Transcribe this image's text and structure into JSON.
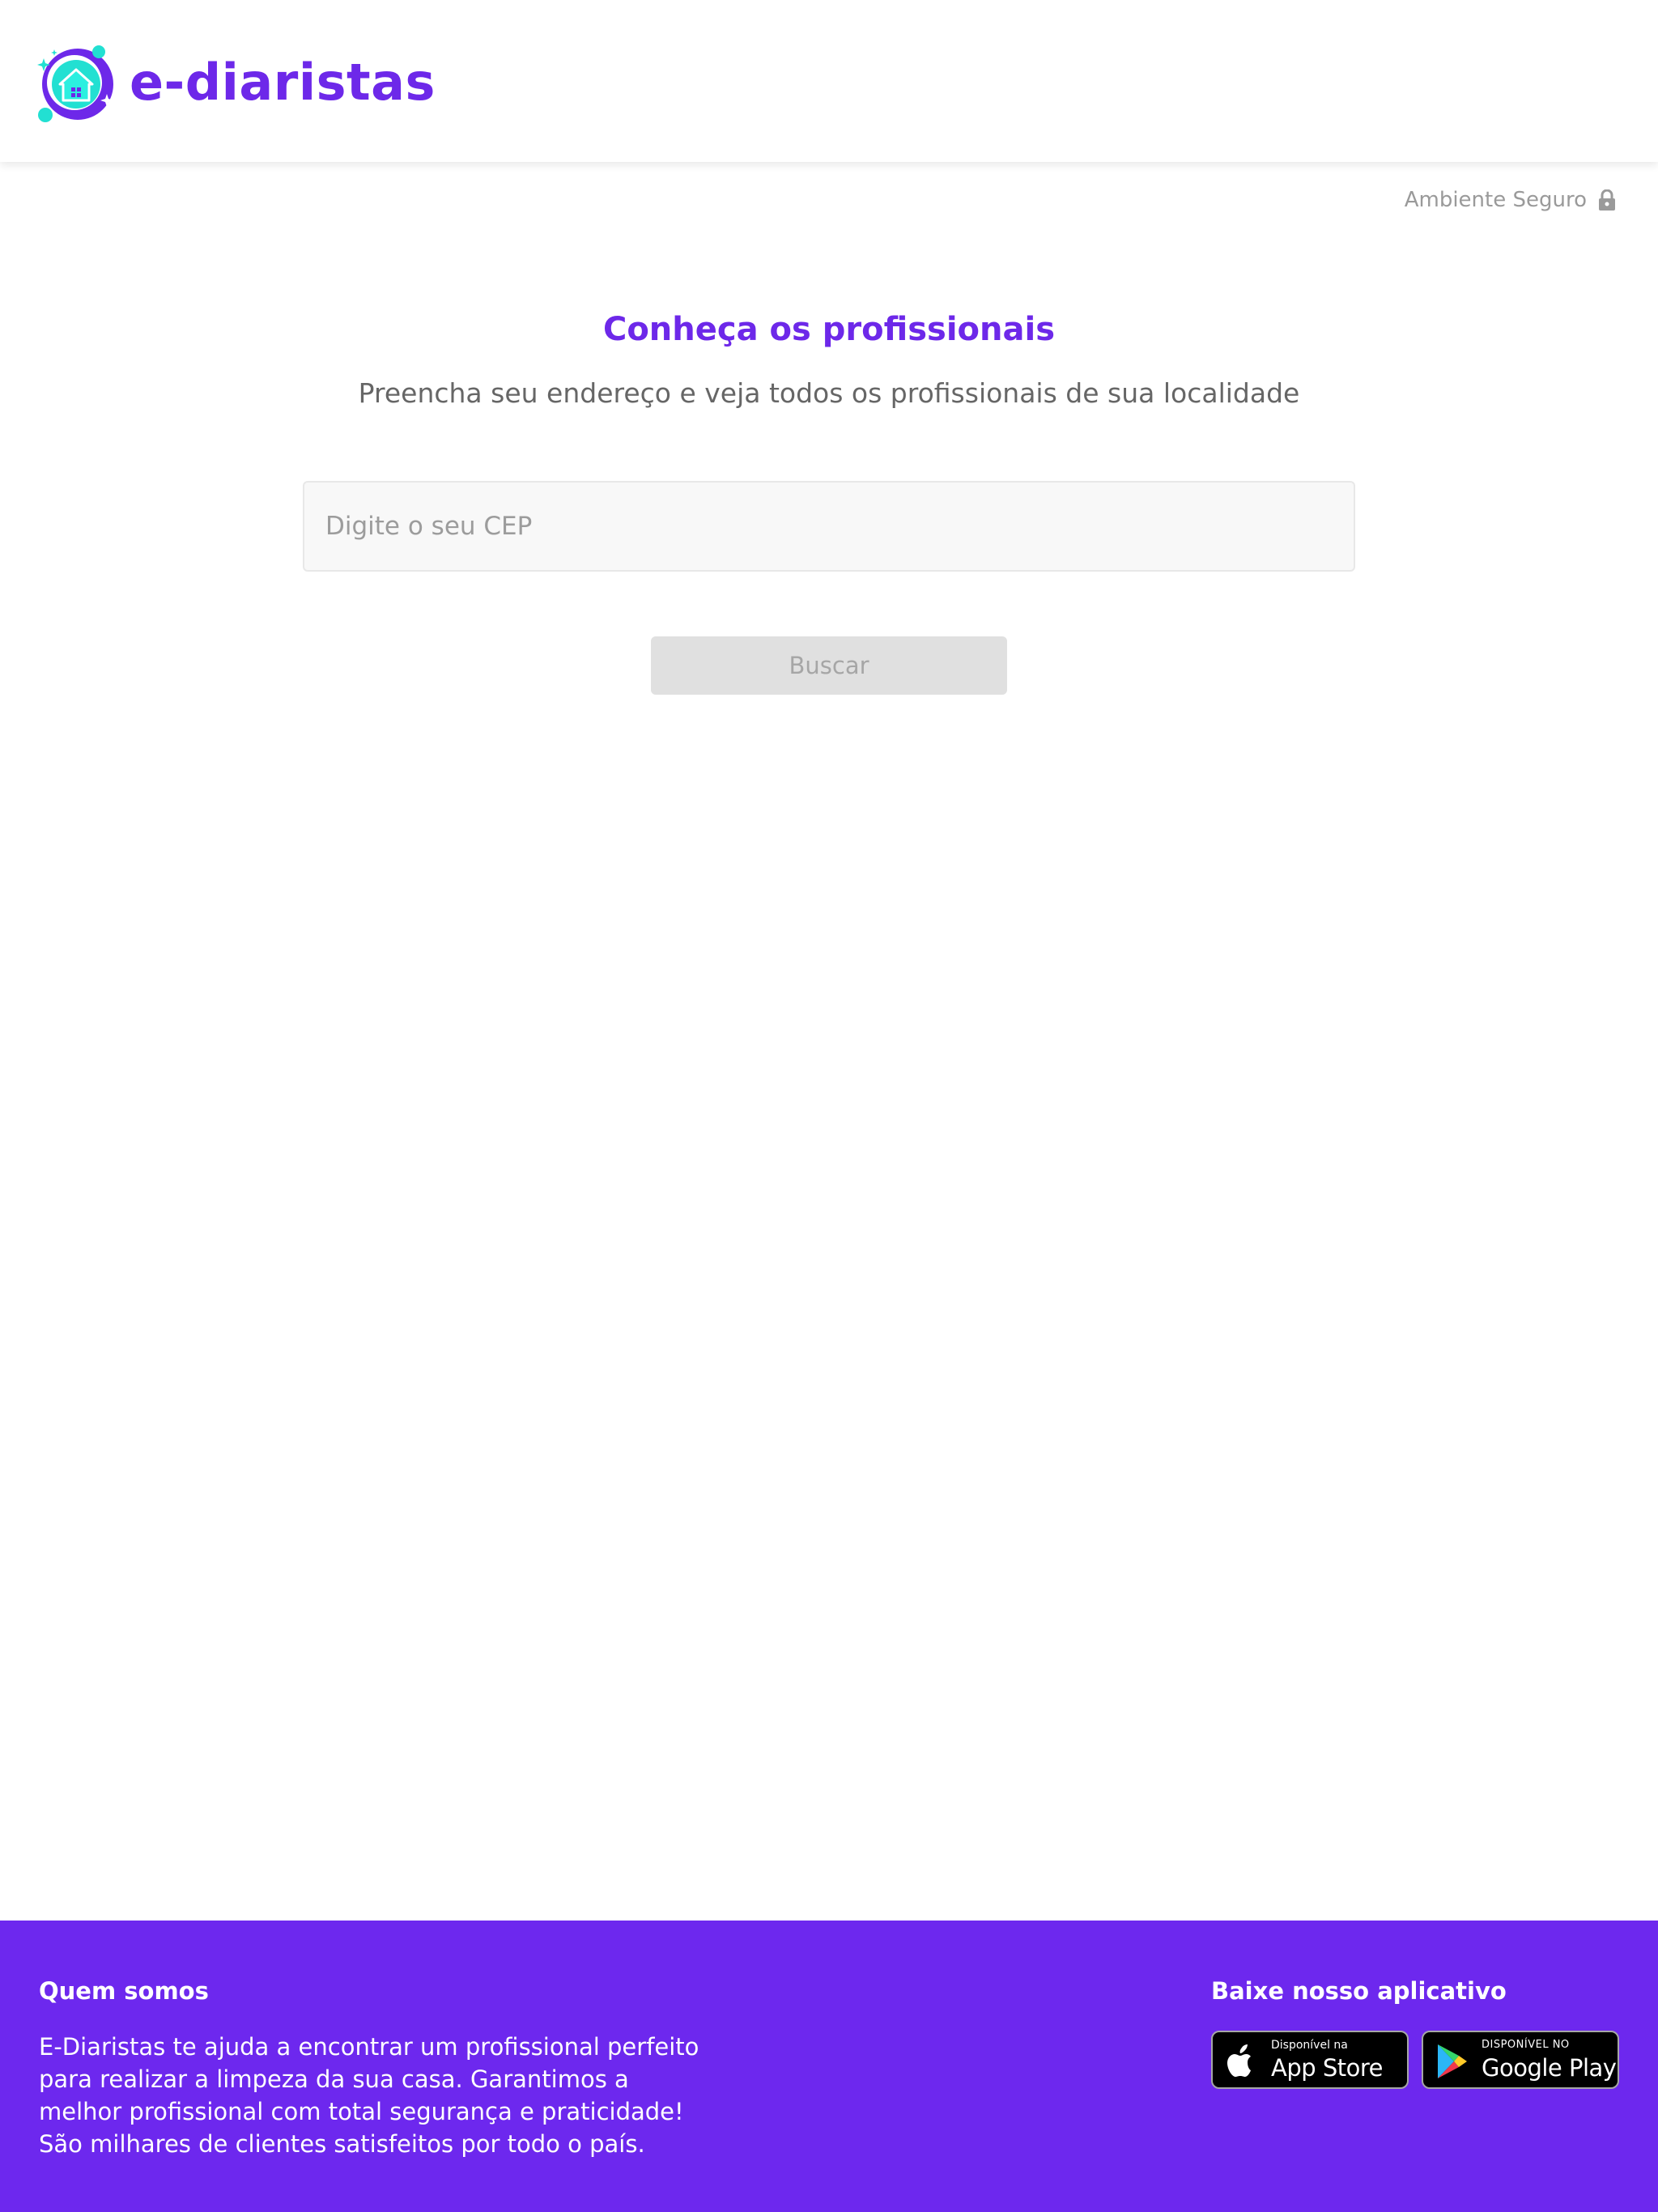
{
  "header": {
    "brand_name": "e-diaristas",
    "logo_icon": "house-cleaning-logo-icon",
    "secure_label": "Ambiente Seguro",
    "secure_icon": "lock-icon"
  },
  "main": {
    "title": "Conheça os profissionais",
    "subtitle": "Preencha seu endereço e veja todos os profissionais de sua localidade",
    "cep_input": {
      "placeholder": "Digite o seu CEP",
      "value": ""
    },
    "search_button_label": "Buscar"
  },
  "footer": {
    "about_heading": "Quem somos",
    "about_text": "E-Diaristas te ajuda a encontrar um profissional perfeito para realizar a limpeza da sua casa. Garantimos a melhor profissional com total segurança e praticidade! São milhares de clientes satisfeitos por todo o país.",
    "app_heading": "Baixe nosso aplicativo",
    "app_store": {
      "small": "Disponível na",
      "big": "App Store",
      "icon": "apple-icon"
    },
    "google_play": {
      "small": "DISPONÍVEL NO",
      "big": "Google Play",
      "icon": "google-play-icon"
    }
  },
  "colors": {
    "brand_purple": "#6D28E9",
    "footer_background": "#6D28EE",
    "logo_teal": "#22E0D2"
  }
}
